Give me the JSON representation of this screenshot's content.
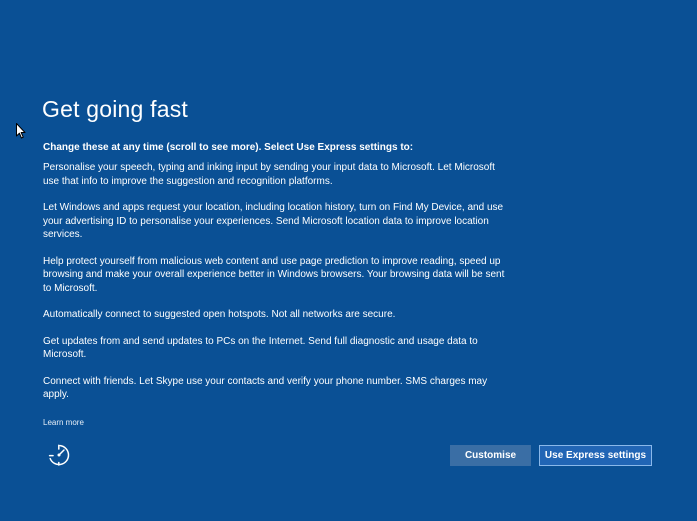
{
  "page": {
    "title": "Get going fast",
    "subtitle": "Change these at any time (scroll to see more). Select Use Express settings to:"
  },
  "settings": [
    "Personalise your speech, typing and inking input by sending your input data to Microsoft. Let Microsoft use that info to improve the suggestion and recognition platforms.",
    "Let Windows and apps request your location, including location history, turn on Find My Device, and use your advertising ID to personalise your experiences. Send Microsoft location data to improve location services.",
    "Help protect yourself from malicious web content and use page prediction to improve reading, speed up browsing and make your overall experience better in Windows browsers. Your browsing data will be sent to Microsoft.",
    "Automatically connect to suggested open hotspots. Not all networks are secure.",
    "Get updates from and send updates to PCs on the Internet. Send full diagnostic and usage data to Microsoft.",
    "Connect with friends. Let Skype use your contacts and verify your phone number. SMS charges may apply."
  ],
  "footer": {
    "learn_more": "Learn more",
    "customise_label": "Customise",
    "express_label": "Use Express settings"
  },
  "icons": {
    "cursor": "mouse-pointer-icon",
    "ease_of_access": "ease-of-access-icon"
  },
  "colors": {
    "background": "#0a5095",
    "customise_button": "#3a6ea5",
    "express_button": "#2165b5",
    "express_border": "#8ab8ea"
  }
}
